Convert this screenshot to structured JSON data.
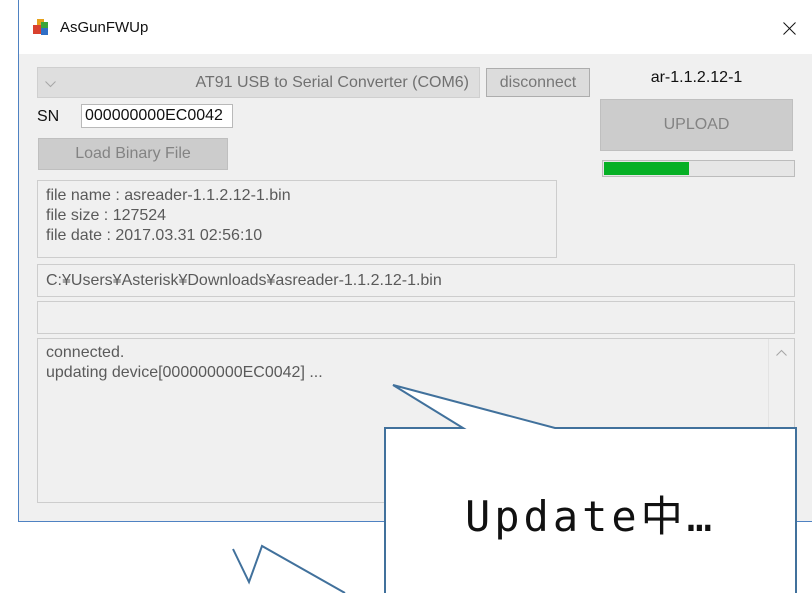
{
  "window": {
    "title": "AsGunFWUp",
    "app_icon": "app-icon",
    "close_icon": "close-icon",
    "border_color": "#4f82c2"
  },
  "connection": {
    "port_select": {
      "value": "AT91 USB to Serial Converter (COM6)",
      "icon": "chevron-down-icon",
      "disabled": true
    },
    "disconnect_label": "disconnect",
    "sn_label": "SN",
    "sn_value": "000000000EC0042"
  },
  "firmware": {
    "version_label": "ar-1.1.2.12-1",
    "upload_label": "UPLOAD",
    "upload_disabled": true,
    "progress": 0.45,
    "progress_color": "#06b025"
  },
  "file": {
    "load_label": "Load Binary File",
    "info_lines": [
      "file name : asreader-1.1.2.12-1.bin",
      "file size : 127524",
      "file date : 2017.03.31 02:56:10"
    ],
    "path": "C:¥Users¥Asterisk¥Downloads¥asreader-1.1.2.12-1.bin",
    "extra_field": ""
  },
  "log": {
    "lines": [
      "connected.",
      "updating device[000000000EC0042] ..."
    ],
    "scroll_up_icon": "chevron-up-icon"
  },
  "annotation": {
    "callout_text": "Update中…",
    "outline_color": "#41719c"
  }
}
